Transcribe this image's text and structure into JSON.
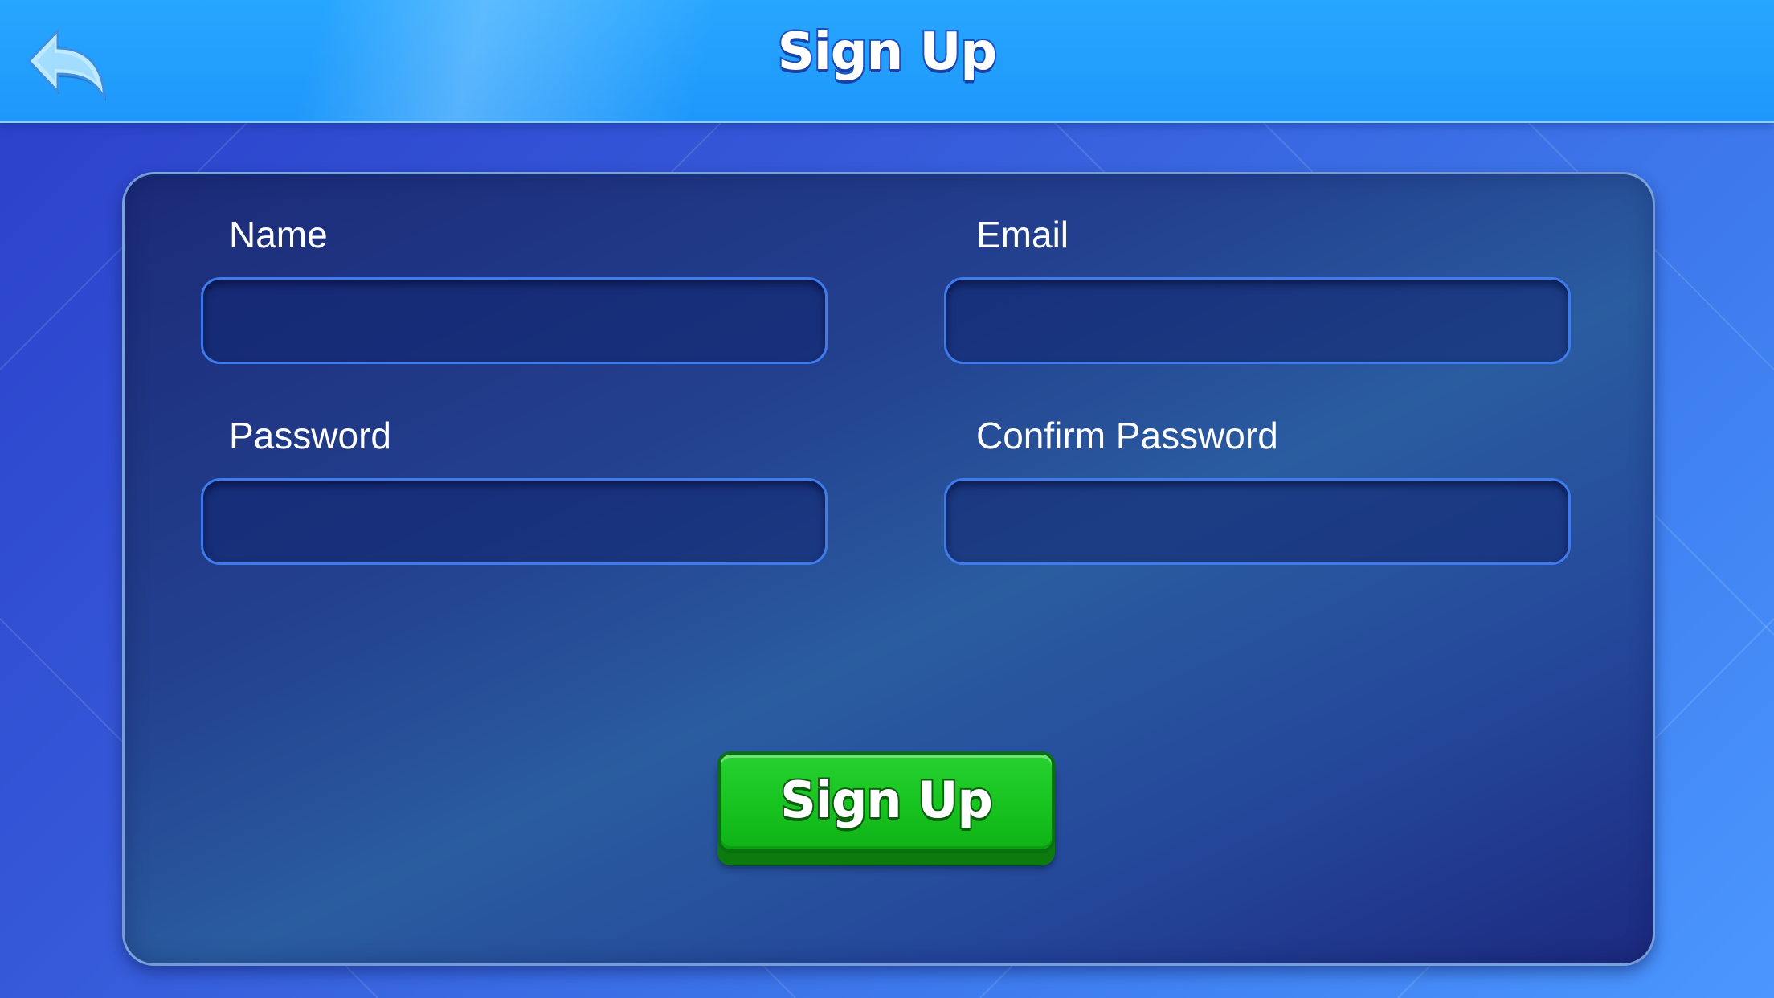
{
  "header": {
    "title": "Sign Up",
    "back_icon": "back-arrow-icon"
  },
  "form": {
    "fields": [
      {
        "label": "Name",
        "value": "",
        "placeholder": ""
      },
      {
        "label": "Email",
        "value": "",
        "placeholder": ""
      },
      {
        "label": "Password",
        "value": "",
        "placeholder": ""
      },
      {
        "label": "Confirm Password",
        "value": "",
        "placeholder": ""
      }
    ],
    "submit_label": "Sign Up"
  },
  "colors": {
    "header_blue": "#1e98fb",
    "panel_navy": "#23418f",
    "input_border": "#3f7bea",
    "button_green": "#17c31f",
    "button_outline": "#0b5d10"
  }
}
